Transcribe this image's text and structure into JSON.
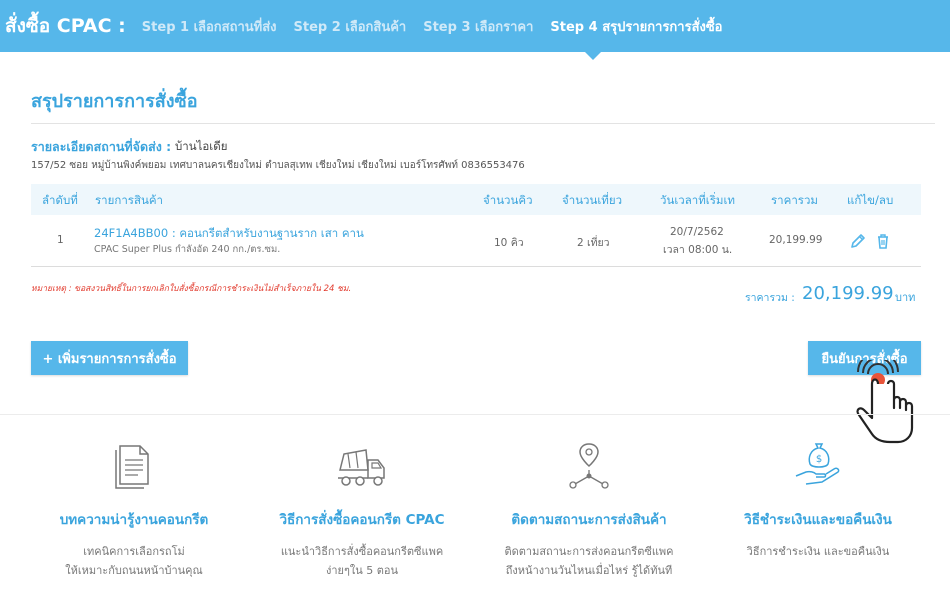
{
  "header": {
    "brand": "สั่งซื้อ CPAC :",
    "steps": [
      {
        "label": "Step 1 เลือกสถานที่ส่ง",
        "active": false
      },
      {
        "label": "Step 2 เลือกสินค้า",
        "active": false
      },
      {
        "label": "Step 3 เลือกราคา",
        "active": false
      },
      {
        "label": "Step 4 สรุปรายการการสั่งซื้อ",
        "active": true
      }
    ]
  },
  "summary": {
    "title": "สรุปรายการการสั่งซื้อ",
    "location_label": "รายละเอียดสถานที่จัดส่ง :",
    "location_name": "บ้านไอเดีย",
    "location_address": "157/52 ซอย หมู่บ้านพิงค์พยอม เทศบาลนครเชียงใหม่ ตำบลสุเทพ เชียงใหม่ เชียงใหม่ เบอร์โทรศัพท์ 0836553476"
  },
  "table": {
    "headers": [
      "ลำดับที่",
      "รายการสินค้า",
      "จำนวนคิว",
      "จำนวนเที่ยว",
      "วันเวลาที่เริ่มเท",
      "ราคารวม",
      "แก้ไข/ลบ"
    ],
    "rows": [
      {
        "index": "1",
        "product_name": "24F1A4BB00 : คอนกรีตสำหรับงานฐานราก เสา คาน",
        "product_desc": "CPAC Super Plus กำลังอัด 240 กก./ตร.ซม.",
        "qty": "10 คิว",
        "trips": "2 เที่ยว",
        "date": "20/7/2562",
        "time": "เวลา 08:00 น.",
        "price": "20,199.99",
        "edit_icon": "pencil-icon",
        "delete_icon": "trash-icon"
      }
    ]
  },
  "note": "หมายเหตุ : ขอสงวนสิทธิ์ในการยกเลิกใบสั่งซื้อกรณีการชำระเงินไม่สำเร็จภายใน 24 ชม.",
  "total": {
    "label": "ราคารวม :",
    "value": "20,199.99",
    "unit": "บาท"
  },
  "buttons": {
    "add": "+ เพิ่มรายการการสั่งซื้อ",
    "confirm": "ยืนยันการสั่งซื้อ"
  },
  "features": [
    {
      "icon": "document-icon",
      "title": "บทความน่ารู้งานคอนกรีต",
      "desc_line1": "เทคนิคการเลือกรถโม่",
      "desc_line2": "ให้เหมาะกับถนนหน้าบ้านคุณ"
    },
    {
      "icon": "concrete-truck-icon",
      "title": "วิธีการสั่งซื้อคอนกรีต CPAC",
      "desc_line1": "แนะนำวิธีการสั่งซื้อคอนกรีตซีแพค",
      "desc_line2": "ง่ายๆใน 5 ตอน"
    },
    {
      "icon": "location-track-icon",
      "title": "ติดตามสถานะการส่งสินค้า",
      "desc_line1": "ติดตามสถานะการส่งคอนกรีตซีแพค",
      "desc_line2": "ถึงหน้างานวันไหนเมื่อไหร่ รู้ได้ทันที"
    },
    {
      "icon": "money-hand-icon",
      "title": "วิธีชำระเงินและขอคืนเงิน",
      "desc_line1": "วิธีการชำระเงิน และขอคืนเงิน",
      "desc_line2": ""
    }
  ],
  "colors": {
    "accent": "#56b7ea",
    "link": "#3aa4dd",
    "warning": "#e23b2e",
    "table_header_bg": "#eef7fc"
  }
}
